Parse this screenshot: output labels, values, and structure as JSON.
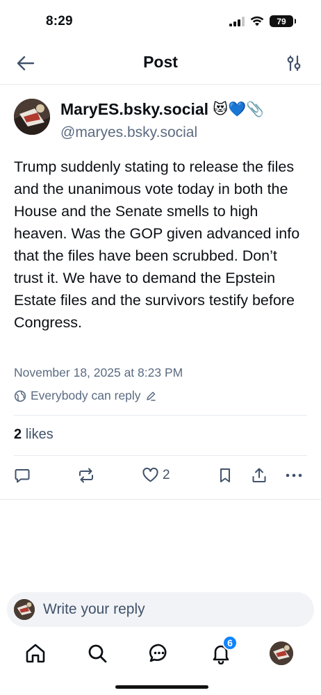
{
  "status": {
    "time": "8:29",
    "battery": "79"
  },
  "header": {
    "title": "Post"
  },
  "post": {
    "author_name": "MaryES.bsky.social",
    "author_emojis": "😻💙📎",
    "author_handle": "@maryes.bsky.social",
    "text": "Trump suddenly stating to release the files and the unanimous vote today in both the House and the Senate smells to high heaven. Was the GOP given advanced info that the files have been scrubbed. Don’t trust it. We have to demand the Epstein Estate files and the survivors testify before Congress.",
    "date": "November 18, 2025 at 8:23 PM",
    "reply_setting": "Everybody can reply",
    "likes_count": "2",
    "likes_label": "likes",
    "like_action_count": "2"
  },
  "reply_bar": {
    "placeholder": "Write your reply"
  },
  "nav": {
    "notifications_badge": "6"
  },
  "colors": {
    "accent": "#1083fe",
    "muted": "#5b6b82",
    "icon": "#42526a"
  },
  "icons": [
    "back-arrow-icon",
    "settings-sliders-icon",
    "globe-icon",
    "pencil-icon",
    "comment-icon",
    "repost-icon",
    "heart-icon",
    "bookmark-icon",
    "share-icon",
    "more-icon",
    "home-icon",
    "search-icon",
    "chat-icon",
    "bell-icon"
  ]
}
